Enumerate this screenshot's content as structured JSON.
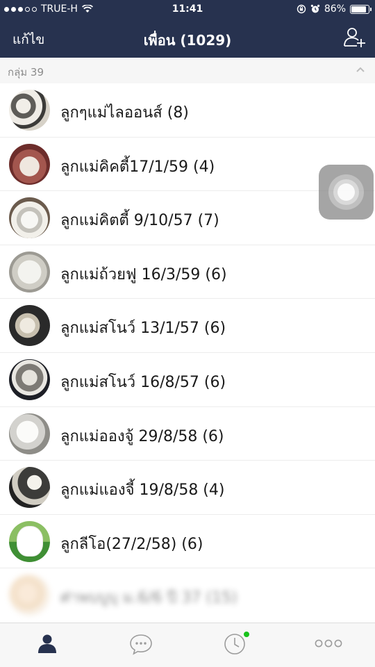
{
  "status_bar": {
    "carrier": "TRUE-H",
    "time": "11:41",
    "battery_percent": "86%",
    "battery_level": 0.86,
    "icons": [
      "signal-dots",
      "wifi-icon",
      "orientation-lock-icon",
      "alarm-icon",
      "battery-icon"
    ]
  },
  "nav": {
    "edit_label": "แก้ไข",
    "title": "เพื่อน (1029)",
    "add_friend_icon": "add-friend-icon"
  },
  "group": {
    "label": "กลุ่ม 39",
    "collapse_icon": "chevron-up-icon"
  },
  "list": [
    {
      "label": "ลูกๆแม่ไลออนส์ (8)"
    },
    {
      "label": "ลูกแม่คิคตี้17/1/59  (4)"
    },
    {
      "label": "ลูกแม่คิตตี้ 9/10/57  (7)"
    },
    {
      "label": "ลูกแม่ถ้วยฟู 16/3/59  (6)"
    },
    {
      "label": "ลูกแม่สโนว์ 13/1/57  (6)"
    },
    {
      "label": "ลูกแม่สโนว์ 16/8/57  (6)"
    },
    {
      "label": "ลูกแม่อองจู้ 29/8/58  (6)"
    },
    {
      "label": "ลูกแม่แองจี้ 19/8/58  (4)"
    },
    {
      "label": "ลูกลีโอ(27/2/58)  (6)"
    },
    {
      "label": "ศ่าพบบูบุ ม.6/6 ปี 37  (15)"
    }
  ],
  "tabs": [
    {
      "name": "friends",
      "icon": "person-icon",
      "active": true
    },
    {
      "name": "chats",
      "icon": "chat-bubble-icon",
      "active": false
    },
    {
      "name": "timeline",
      "icon": "clock-icon",
      "active": false,
      "badge": "new-dot"
    },
    {
      "name": "more",
      "icon": "more-dots-icon",
      "active": false
    }
  ],
  "colors": {
    "header_bg": "#27324f",
    "group_bg": "#f6f6f6",
    "tab_active": "#27324f",
    "tab_inactive": "#9c9c9c",
    "badge": "#19c21c"
  }
}
